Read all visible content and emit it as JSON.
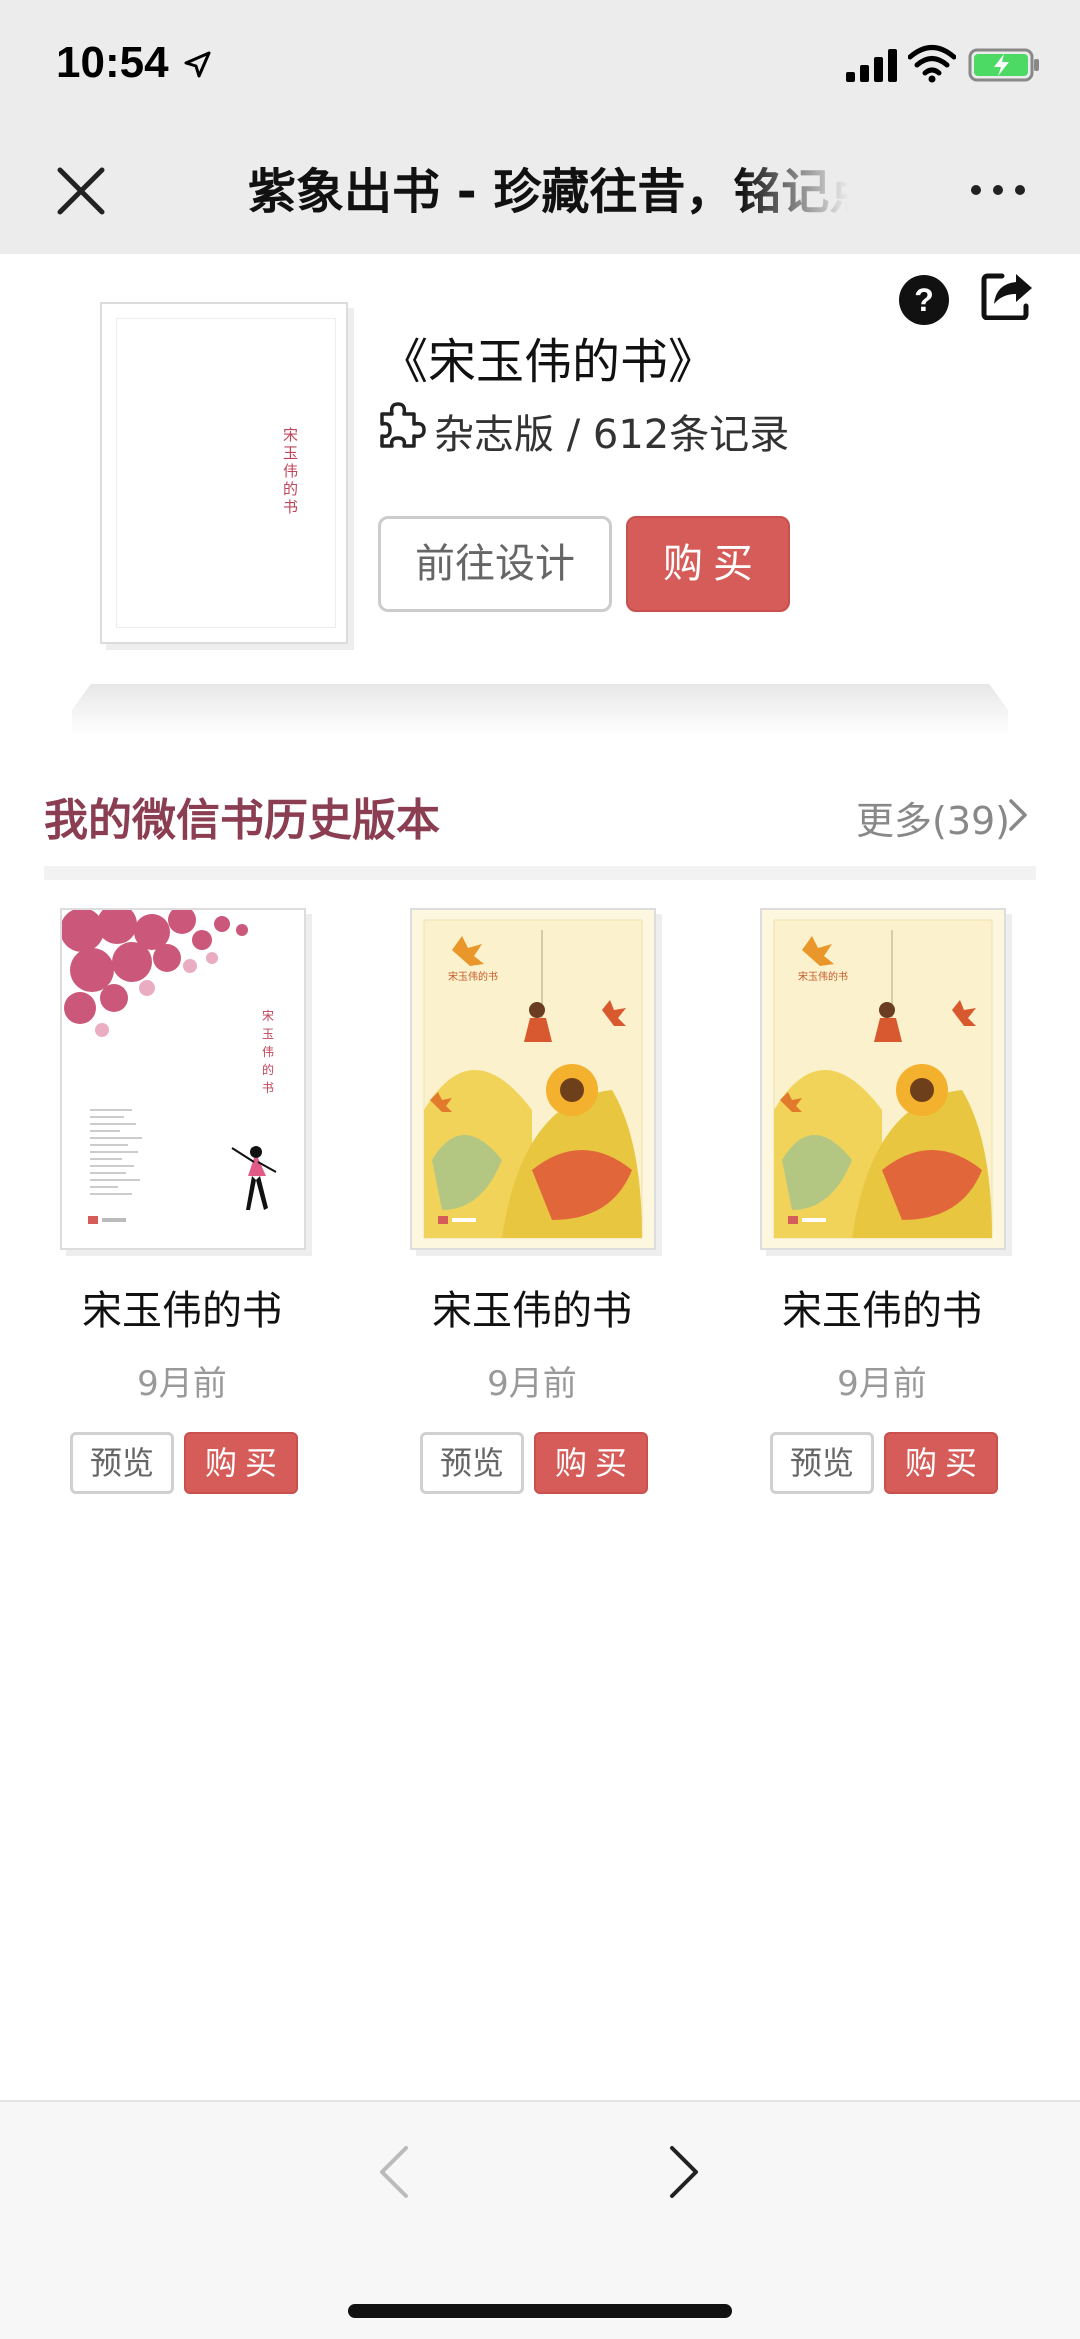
{
  "status_bar": {
    "time": "10:54"
  },
  "nav": {
    "title": "紫象出书 - 珍藏往昔，铭记点滴"
  },
  "book": {
    "title": "《宋玉伟的书》",
    "meta": "杂志版 / 612条记录",
    "cover_title": "宋玉伟的书",
    "design_label": "前往设计",
    "buy_label": "购买"
  },
  "history": {
    "title": "我的微信书历史版本",
    "more_label": "更多(39)",
    "items": [
      {
        "title": "宋玉伟的书",
        "time": "9月前",
        "preview_label": "预览",
        "buy_label": "购买"
      },
      {
        "title": "宋玉伟的书",
        "time": "9月前",
        "preview_label": "预览",
        "buy_label": "购买"
      },
      {
        "title": "宋玉伟的书",
        "time": "9月前",
        "preview_label": "预览",
        "buy_label": "购买"
      }
    ]
  },
  "colors": {
    "accent_red": "#d55c59",
    "section_title": "#8b3d52"
  },
  "icons": {
    "close": "close-icon",
    "more": "more-icon",
    "help": "help-icon",
    "share": "share-icon",
    "puzzle": "puzzle-icon",
    "back": "back-arrow-icon",
    "forward": "forward-arrow-icon"
  }
}
